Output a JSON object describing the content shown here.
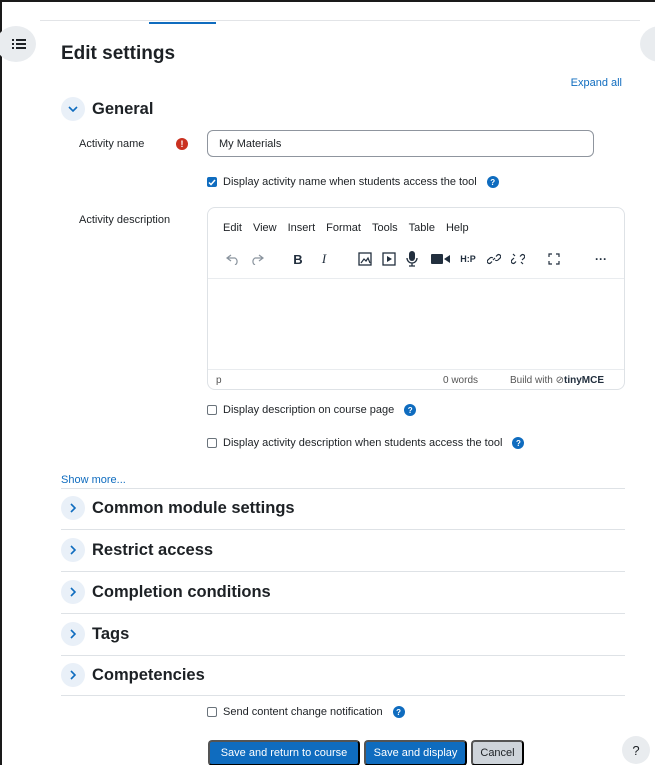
{
  "page": {
    "title": "Edit settings",
    "expand_all": "Expand all"
  },
  "general": {
    "title": "General",
    "activity_name_label": "Activity name",
    "activity_name_value": "My Materials",
    "display_name_label": "Display activity name when students access the tool",
    "activity_description_label": "Activity description"
  },
  "editor": {
    "menu": [
      "Edit",
      "View",
      "Insert",
      "Format",
      "Tools",
      "Table",
      "Help"
    ],
    "status_path": "p",
    "word_count": "0 words",
    "brand_prefix": "Build with",
    "brand_name": "tinyMCE"
  },
  "options": {
    "display_description": "Display description on course page",
    "display_activity_description": "Display activity description when students access the tool"
  },
  "show_more": "Show more...",
  "sections": [
    {
      "title": "Common module settings"
    },
    {
      "title": "Restrict access"
    },
    {
      "title": "Completion conditions"
    },
    {
      "title": "Tags"
    },
    {
      "title": "Competencies"
    }
  ],
  "notification": {
    "label": "Send content change notification"
  },
  "buttons": {
    "save_return": "Save and return to course",
    "save_display": "Save and display",
    "cancel": "Cancel"
  },
  "help_fab": "?",
  "colors": {
    "primary": "#0f6cbf",
    "danger": "#ca3120"
  }
}
